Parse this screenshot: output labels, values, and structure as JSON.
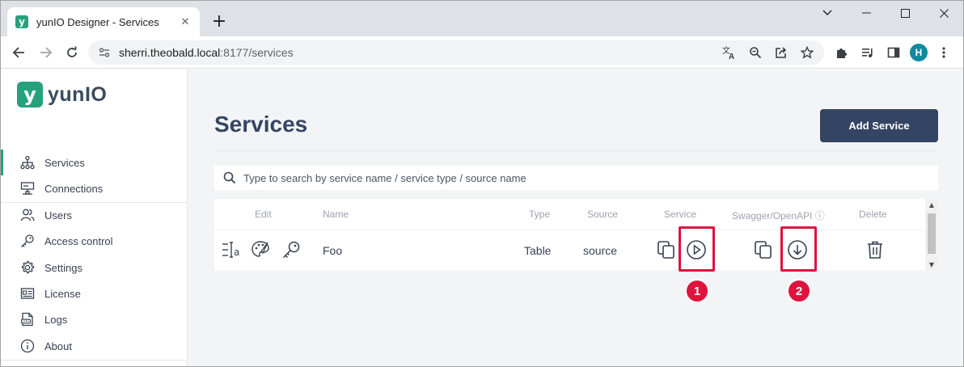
{
  "browser": {
    "tab_title": "yunIO Designer - Services",
    "favicon_letter": "y",
    "new_tab": "+",
    "url_host": "sherri.theobald.local",
    "url_path": ":8177/services",
    "avatar_letter": "H"
  },
  "app": {
    "logo_mark": "y",
    "logo_text": "yunIO",
    "accent_color": "#27a17b",
    "primary_color": "#344563",
    "annotation_color": "#e0123e"
  },
  "sidebar": {
    "items": [
      {
        "label": "Services",
        "icon": "hierarchy-icon",
        "active": true
      },
      {
        "label": "Connections",
        "icon": "connection-icon"
      },
      {
        "label": "Users",
        "icon": "users-icon"
      },
      {
        "label": "Access control",
        "icon": "key-icon"
      },
      {
        "label": "Settings",
        "icon": "gear-icon"
      },
      {
        "label": "License",
        "icon": "license-card-icon"
      },
      {
        "label": "Logs",
        "icon": "log-file-icon"
      },
      {
        "label": "About",
        "icon": "info-icon"
      }
    ]
  },
  "main": {
    "title": "Services",
    "add_button": "Add Service",
    "search_placeholder": "Type to search by service name / service type / source name"
  },
  "table": {
    "headers": {
      "edit": "Edit",
      "name": "Name",
      "type": "Type",
      "source": "Source",
      "service": "Service",
      "swagger": "Swagger/OpenAPI ⓘ",
      "delete": "Delete"
    },
    "rows": [
      {
        "name": "Foo",
        "type": "Table",
        "source": "source"
      }
    ]
  },
  "annotations": {
    "badge1": "1",
    "badge2": "2"
  }
}
